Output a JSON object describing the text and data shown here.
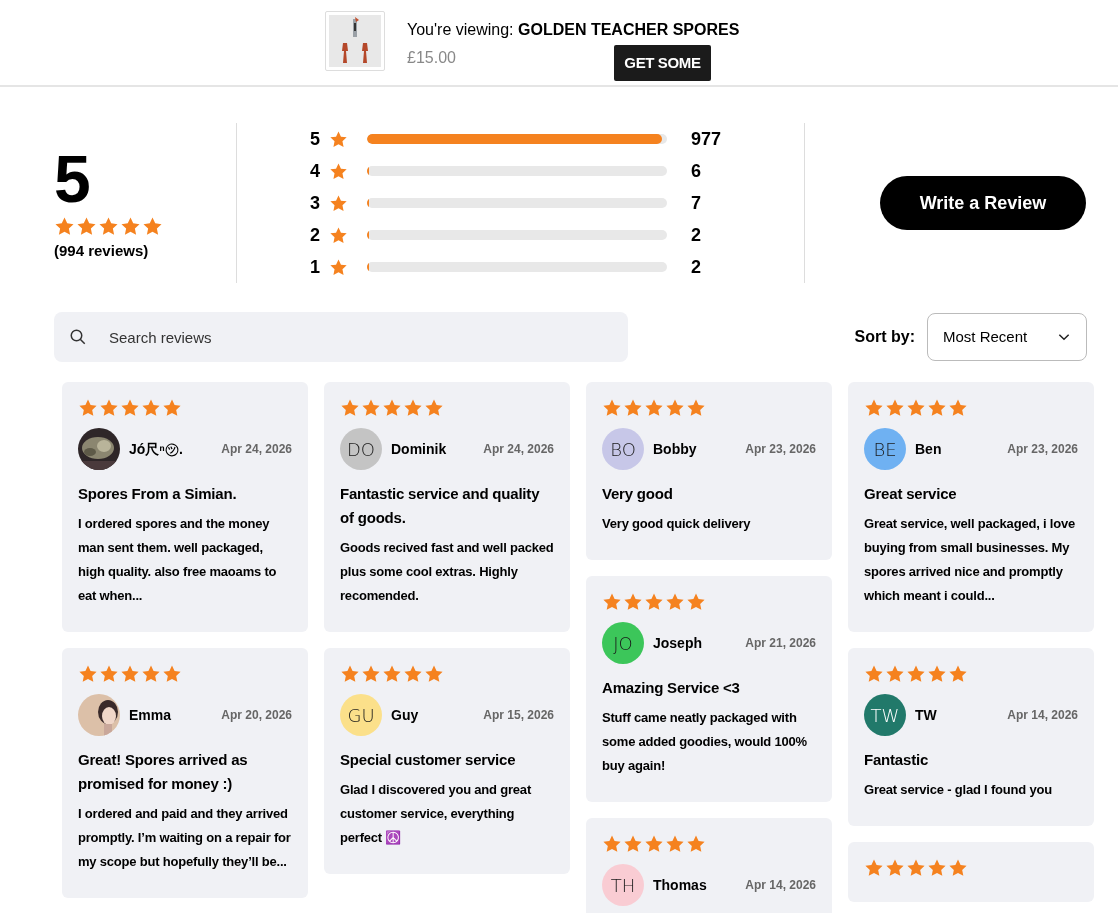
{
  "product_bar": {
    "viewing_label": "You're viewing:",
    "product_name": "GOLDEN TEACHER SPORES",
    "price": "£15.00",
    "button": "GET SOME"
  },
  "summary": {
    "average": "5",
    "stars": 5,
    "review_count": "(994 reviews)"
  },
  "rating_bars": [
    {
      "label": "5",
      "level": 0.983,
      "count": "977"
    },
    {
      "label": "4",
      "level": 0.006,
      "count": "6"
    },
    {
      "label": "3",
      "level": 0.007,
      "count": "7"
    },
    {
      "label": "2",
      "level": 0.002,
      "count": "2"
    },
    {
      "label": "1",
      "level": 0.002,
      "count": "2"
    }
  ],
  "write_review_button": "Write a Review",
  "search": {
    "placeholder": "Search reviews"
  },
  "sort": {
    "label": "Sort by:",
    "value": "Most Recent"
  },
  "review_columns": [
    [
      {
        "stars": 5,
        "name": "Jó尺ⁿ㋡.",
        "date": "Apr 24, 2026",
        "title": "Spores From a Simian.",
        "body": "I ordered spores and the money man sent them. well packaged, high quality. also free maoams to eat when..."
      },
      {
        "stars": 5,
        "name": "Emma",
        "date": "Apr 20, 2026",
        "title": "Great! Spores arrived as promised for money :)",
        "body": "I ordered and paid and they arrived promptly. I’m waiting on a repair for my scope but hopefully they’ll be..."
      }
    ],
    [
      {
        "stars": 5,
        "avatar": {
          "kind": "initials",
          "initials": "DO",
          "color": "#c4c4c4"
        },
        "name": "Dominik",
        "date": "Apr 24, 2026",
        "title": "Fantastic service and quality of goods.",
        "body": "Goods recived fast and well packed plus some cool extras. Highly recomended."
      },
      {
        "stars": 5,
        "avatar": {
          "kind": "initials",
          "initials": "GU",
          "color": "#fbe08a"
        },
        "name": "Guy",
        "date": "Apr 15, 2026",
        "title": "Special customer service",
        "body": "Glad I discovered you and great customer service, everything perfect ☮️"
      }
    ],
    [
      {
        "stars": 5,
        "avatar": {
          "kind": "initials",
          "initials": "BO",
          "color": "#c7c7e8"
        },
        "name": "Bobby",
        "date": "Apr 23, 2026",
        "title": "Very good",
        "body": "Very good quick delivery"
      },
      {
        "stars": 5,
        "avatar": {
          "kind": "initials",
          "initials": "JO",
          "color": "#3cc65a"
        },
        "name": "Joseph",
        "date": "Apr 21, 2026",
        "title": "Amazing Service <3",
        "body": "Stuff came neatly packaged with some added goodies, would 100% buy again!"
      },
      {
        "stars": 5,
        "avatar": {
          "kind": "initials",
          "initials": "TH",
          "color": "#f9ccd3"
        },
        "name": "Thomas",
        "date": "Apr 14, 2026"
      }
    ],
    [
      {
        "stars": 5,
        "avatar": {
          "kind": "initials",
          "initials": "BE",
          "color": "#6fb1f2"
        },
        "name": "Ben",
        "date": "Apr 23, 2026",
        "title": "Great service",
        "body": "Great service, well packaged, i love buying from small businesses. My spores arrived nice and promptly which meant i could..."
      },
      {
        "stars": 5,
        "avatar": {
          "kind": "initials",
          "initials": "TW",
          "color": "#21796a"
        },
        "name": "TW",
        "date": "Apr 14, 2026",
        "title": "Fantastic",
        "body": "Great service - glad I found you"
      },
      {
        "stars": 5
      }
    ]
  ]
}
